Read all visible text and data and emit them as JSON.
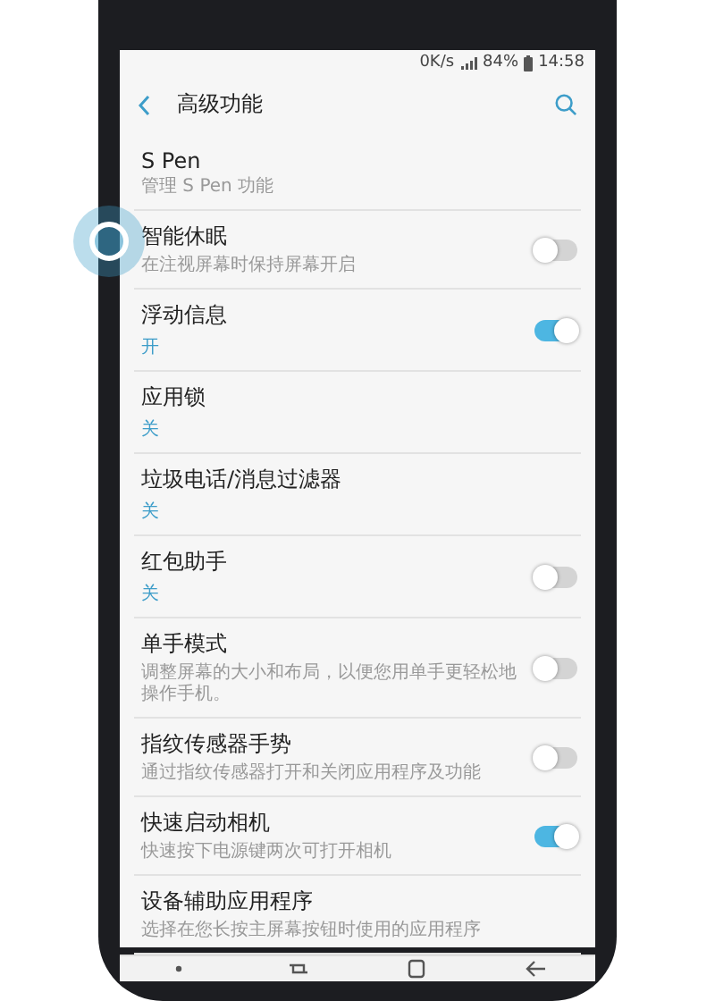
{
  "status_bar": {
    "speed": "0K/s",
    "battery": "84%",
    "time": "14:58"
  },
  "header": {
    "title": "高级功能"
  },
  "items": [
    {
      "kind": "plain",
      "title": "S Pen",
      "description": "管理 S Pen 功能"
    },
    {
      "kind": "toggle",
      "title": "智能休眠",
      "description": "在注视屏幕时保持屏幕开启",
      "on": false
    },
    {
      "kind": "toggle",
      "title": "浮动信息",
      "status": "开",
      "on": true
    },
    {
      "kind": "plain",
      "title": "应用锁",
      "status": "关"
    },
    {
      "kind": "plain",
      "title": "垃圾电话/消息过滤器",
      "status": "关"
    },
    {
      "kind": "toggle",
      "title": "红包助手",
      "status": "关",
      "on": false
    },
    {
      "kind": "toggle",
      "title": "单手模式",
      "description": "调整屏幕的大小和布局，以便您用单手更轻松地操作手机。",
      "on": false
    },
    {
      "kind": "toggle",
      "title": "指纹传感器手势",
      "description": "通过指纹传感器打开和关闭应用程序及功能",
      "on": false
    },
    {
      "kind": "toggle",
      "title": "快速启动相机",
      "description": "快速按下电源键两次可打开相机",
      "on": true
    },
    {
      "kind": "plain",
      "title": "设备辅助应用程序",
      "description": "选择在您长按主屏幕按钮时使用的应用程序"
    }
  ]
}
